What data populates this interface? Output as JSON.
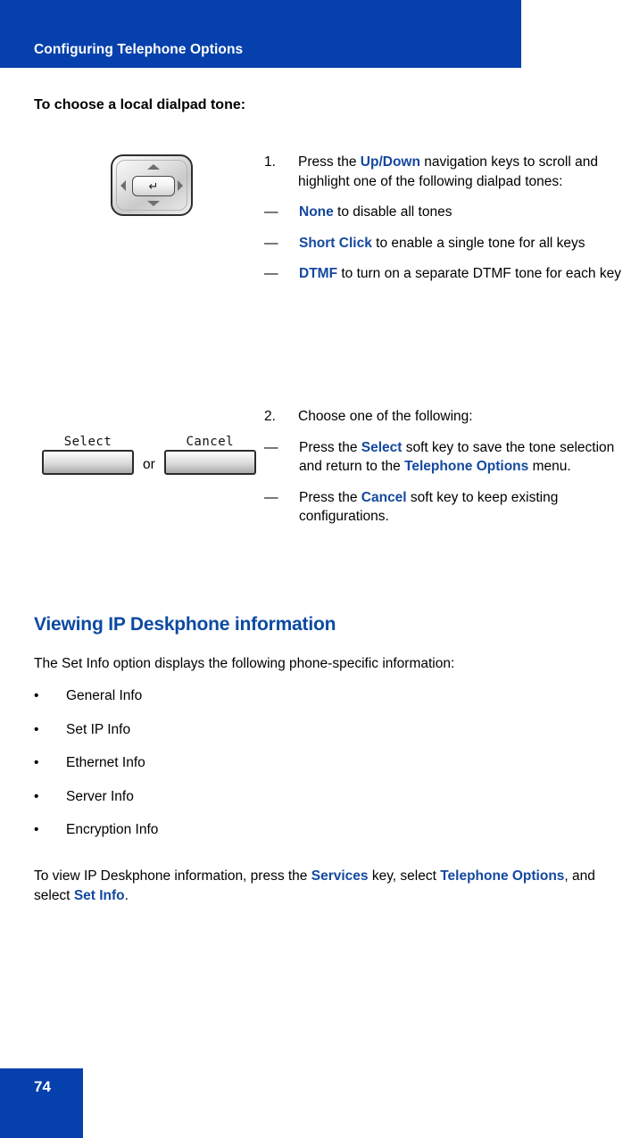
{
  "page": {
    "running_header": "Configuring Telephone Options",
    "page_number": "74",
    "accent_blue": "#0540ac",
    "link_blue": "#14489f",
    "heading_blue": "#0b4aa2"
  },
  "procedure": {
    "title": "To choose a local dialpad tone:",
    "steps": [
      {
        "number": "1.",
        "lead_pre": "Press the ",
        "lead_kw": "Up/Down",
        "lead_post": " navigation keys to scroll and highlight one of the following dialpad tones:",
        "items": [
          {
            "dash": "—",
            "kw": "None",
            "rest": " to disable all tones"
          },
          {
            "dash": "—",
            "kw": "Short Click",
            "rest": " to enable a single tone for all keys"
          },
          {
            "dash": "—",
            "kw": "DTMF",
            "rest": " to turn on a separate DTMF tone for each key"
          }
        ],
        "art": {
          "type": "navigation-key-cluster",
          "center_glyph": "↵",
          "directions": [
            "up",
            "down",
            "left",
            "right"
          ]
        }
      },
      {
        "number": "2.",
        "lead": "Choose one of the following:",
        "items": [
          {
            "dash": "—",
            "pre": "Press the ",
            "kw": "Select",
            "mid": " soft key to save the tone selection and return to the ",
            "kw2": "Telephone Options",
            "post": " menu."
          },
          {
            "dash": "—",
            "pre": "Press the ",
            "kw": "Cancel",
            "mid": " soft key to keep existing configurations.",
            "kw2": "",
            "post": ""
          }
        ],
        "art": {
          "type": "soft-keys",
          "left_label": "Select",
          "conjunction": "or",
          "right_label": "Cancel"
        }
      }
    ]
  },
  "section": {
    "heading": "Viewing IP Deskphone information",
    "intro": "The Set Info option displays the following phone-specific information:",
    "bullet_mark": "•",
    "bullets": [
      "General Info",
      "Set IP Info",
      "Ethernet Info",
      "Server Info",
      "Encryption Info"
    ],
    "outro": {
      "part1": "To view IP Deskphone information, press the ",
      "kw1": "Services",
      "part2": " key, select ",
      "kw2": "Telephone Options",
      "part3": ", and select ",
      "kw3": "Set Info",
      "part4": "."
    }
  }
}
